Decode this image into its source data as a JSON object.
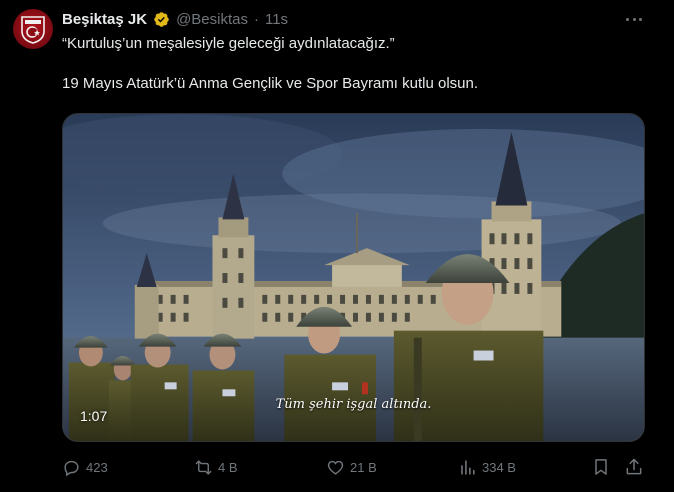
{
  "author": {
    "display_name": "Beşiktaş JK",
    "handle": "@Besiktas",
    "separator": "·",
    "time": "11s"
  },
  "tweet": {
    "line1": "“Kurtuluş’un meşalesiyle geleceği aydınlatacağız.”",
    "line2": "19 Mayıs Atatürk’ü Anma Gençlik ve Spor Bayramı kutlu olsun."
  },
  "video": {
    "subtitle": "Tüm şehir işgal altında.",
    "duration": "1:07"
  },
  "actions": {
    "replies": "423",
    "reposts": "4 B",
    "likes": "21 B",
    "views": "334 B"
  },
  "colors": {
    "background": "#000000",
    "text": "#e7e9ea",
    "muted": "#71767b",
    "verified_gold": "#e2b719",
    "avatar_red": "#b3121b"
  },
  "icons": [
    "more-icon",
    "verified-badge-icon",
    "reply-icon",
    "repost-icon",
    "like-icon",
    "views-icon",
    "bookmark-icon",
    "share-icon"
  ]
}
